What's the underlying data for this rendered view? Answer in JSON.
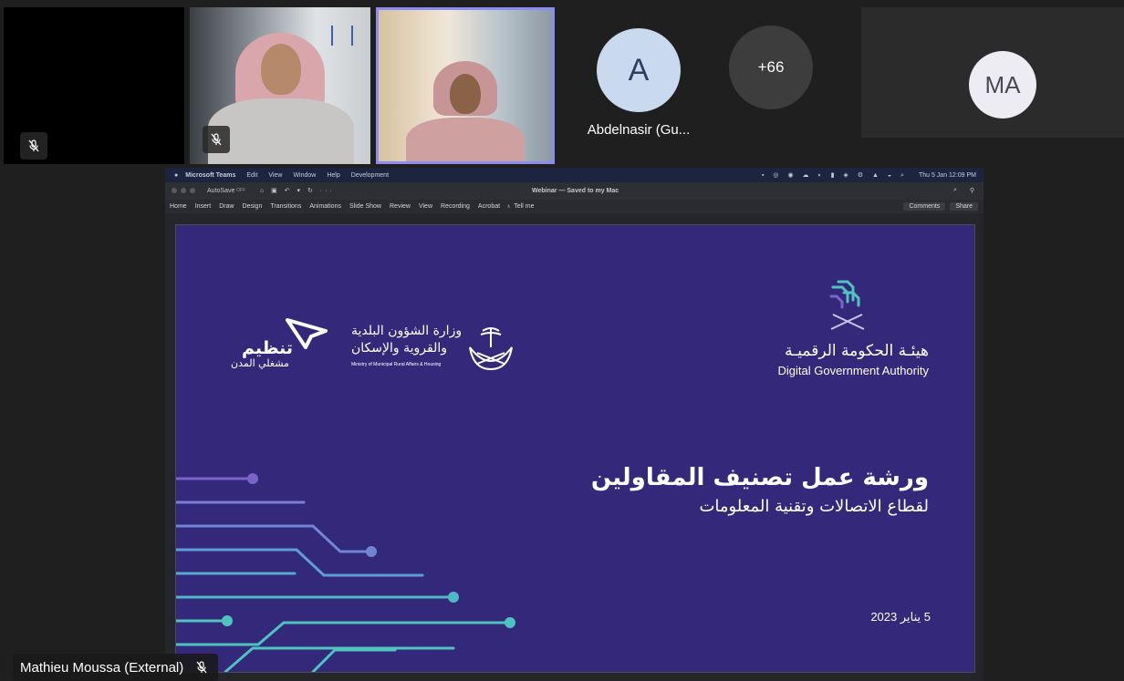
{
  "participants": [
    {
      "id": "p1",
      "muted": true
    },
    {
      "id": "p2",
      "muted": true
    },
    {
      "id": "p3",
      "active_speaker": true
    },
    {
      "id": "p4",
      "avatar_initial": "A",
      "name": "Abdelnasir (Gu..."
    },
    {
      "id": "p5",
      "overflow_label": "+66"
    },
    {
      "id": "p6",
      "avatar_initial": "MA"
    }
  ],
  "presenter": {
    "name": "Mathieu Moussa (External)"
  },
  "mac_menubar": {
    "app": "Microsoft Teams",
    "items": [
      "Edit",
      "View",
      "Window",
      "Help",
      "Development"
    ],
    "clock": "Thu 5 Jan  12:09 PM"
  },
  "ppt": {
    "autosave": "AutoSave",
    "autosave_state": "OFF",
    "file_title": "Webinar — Saved to my Mac",
    "tabs": [
      "Home",
      "Insert",
      "Draw",
      "Design",
      "Transitions",
      "Animations",
      "Slide Show",
      "Review",
      "View",
      "Recording",
      "Acrobat"
    ],
    "tell_me": "Tell me",
    "comments": "Comments",
    "share": "Share"
  },
  "slide": {
    "dga_arabic": "هيئـة الحكومة الرقميـة",
    "dga_english": "Digital Government Authority",
    "ministry_arabic_1": "وزارة الشؤون البلدية",
    "ministry_arabic_2": "والقروية والإسكان",
    "ministry_english": "Ministry of Municipal Rural Affairs & Housing",
    "tanzeem_1": "تنظيم",
    "tanzeem_2": "مشغلي المدن",
    "title_line1": "ورشة عمل تصنيف المقاولين",
    "title_line2": "لقطاع الاتصالات وتقنية المعلومات",
    "date": "5 يناير 2023"
  },
  "colors": {
    "background": "#1f1f1f",
    "active_speaker_border": "#8b8cf0",
    "avatar_light": "#c9d9ee",
    "avatar_ma": "#ececf2",
    "overflow_circle": "#3d3d3d",
    "slide_bg": "#33287a",
    "circuit_teal": "#4fc3c0",
    "circuit_purple": "#7a63c9"
  }
}
